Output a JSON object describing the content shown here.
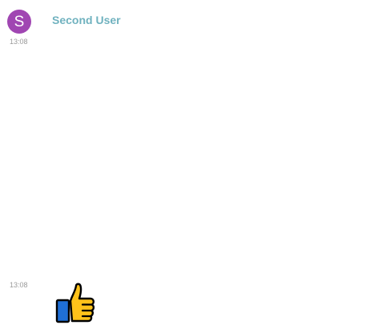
{
  "messages": [
    {
      "sender": {
        "name": "Second User",
        "avatar_initial": "S",
        "avatar_color": "#a046b2",
        "name_color": "#70b2bf"
      },
      "time": "13:08"
    },
    {
      "time": "13:08",
      "content": {
        "type": "emoji",
        "icon": "thumbs-up-icon"
      }
    }
  ]
}
